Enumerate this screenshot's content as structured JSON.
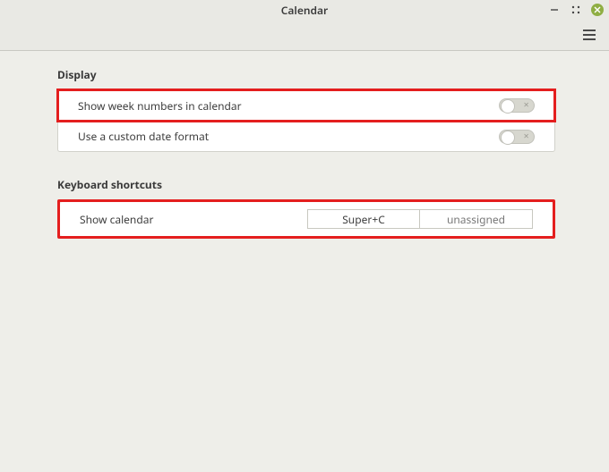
{
  "window": {
    "title": "Calendar"
  },
  "sections": {
    "display": {
      "title": "Display",
      "rows": {
        "week_numbers": {
          "label": "Show week numbers in calendar",
          "on": false
        },
        "custom_date": {
          "label": "Use a custom date format",
          "on": false
        }
      }
    },
    "shortcuts": {
      "title": "Keyboard shortcuts",
      "rows": {
        "show_calendar": {
          "label": "Show calendar",
          "binding1": "Super+C",
          "binding2": "unassigned"
        }
      }
    }
  }
}
